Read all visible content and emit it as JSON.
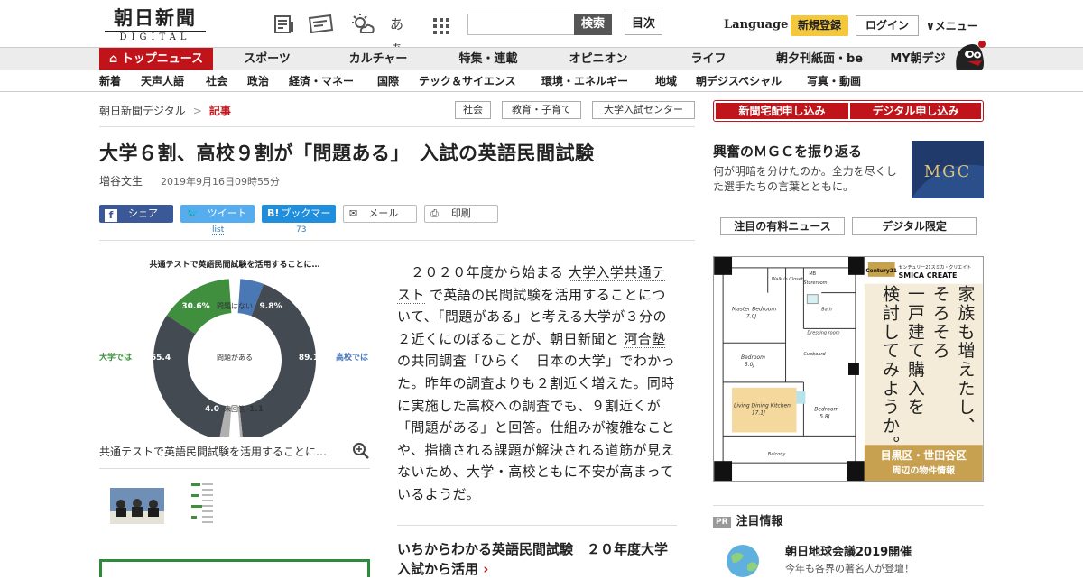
{
  "header": {
    "logo_main": "朝日新聞",
    "logo_sub": "DIGITAL",
    "icons": [
      "newspaper-icon",
      "ticket-icon",
      "weather-icon",
      "font-size-icon",
      "grid-icon"
    ],
    "font_icon_text": "あぁ",
    "search_placeholder": "",
    "search_button": "検索",
    "toc_button": "目次",
    "language": "Language",
    "register_button": "新規登録",
    "login_button": "ログイン",
    "menu_button": "∨メニュー"
  },
  "nav_primary": [
    {
      "label": "トップニュース",
      "active": true
    },
    {
      "label": "スポーツ"
    },
    {
      "label": "カルチャー"
    },
    {
      "label": "特集・連載"
    },
    {
      "label": "オピニオン"
    },
    {
      "label": "ライフ"
    },
    {
      "label": "朝夕刊紙面・be"
    },
    {
      "label": "MY朝デジ"
    }
  ],
  "nav_secondary": [
    "新着",
    "天声人語",
    "社会",
    "政治",
    "経済・マネー",
    "国際",
    "テック＆サイエンス",
    "環境・エネルギー",
    "地域",
    "朝デジスペシャル",
    "写真・動画"
  ],
  "breadcrumb": {
    "home": "朝日新聞デジタル",
    "separator": ">",
    "current": "記事"
  },
  "tags": [
    "社会",
    "教育・子育て",
    "大学入試センター"
  ],
  "article": {
    "headline": "大学６割、高校９割が「問題ある」　入試の英語民間試験",
    "author": "増谷文生",
    "date": "2019年9月16日09時55分",
    "share": {
      "facebook": "シェア",
      "twitter": "ツイート",
      "hatena": "ブックマーク",
      "mail": "メール",
      "print": "印刷"
    },
    "share_counts": {
      "twitter": "list",
      "hatena": "73"
    },
    "body_parts": {
      "p1": "２０２０年度から始まる",
      "link1": "大学入学共通テスト",
      "p2": "で英語の民間試験を活用することについて、「問題がある」と考える大学が３分の２近くにのぼることが、朝日新聞と",
      "link2": "河合塾",
      "p3": "の共同調査「ひらく　日本の大学」でわかった。昨年の調査よりも２割近く増えた。同時に実施した高校への調査でも、９割近くが「問題がある」と回答。仕組みが複雑なことや、指摘される課題が解決される道筋が見えないため、大学・高校ともに不安が高まっているようだ。"
    },
    "related_title": "いちからわかる英語民間試験　２０年度大学入試から活用",
    "related_arrow": "›",
    "figure_caption": "共通テストで英語民間試験を活用することに…"
  },
  "chart_data": {
    "type": "pie",
    "title": "共通テストで英語民間試験を活用することに…",
    "legend_left": "大学では",
    "legend_right": "高校では",
    "categories": [
      "問題はない",
      "問題がある",
      "未回答"
    ],
    "series": [
      {
        "name": "大学では",
        "values": [
          30.6,
          65.4,
          4.0
        ]
      },
      {
        "name": "高校では",
        "values": [
          9.8,
          89.1,
          1.1
        ]
      }
    ],
    "labels": {
      "univ_ok": "30.6%",
      "high_ok": "9.8%",
      "univ_problem": "65.4",
      "high_problem": "89.1",
      "univ_none": "4.0",
      "high_none": "1.1",
      "center_ok": "問題はない",
      "center_problem": "問題がある",
      "center_none": "未回答"
    },
    "colors": {
      "ok_univ": "#3f8f3f",
      "ok_high": "#4a78b5",
      "problem": "#444a52",
      "none": "#b0b0b0"
    }
  },
  "sidebar": {
    "delivery_button": "新聞宅配申し込み",
    "digital_button": "デジタル申し込み",
    "promo_title": "興奮のＭＧＣを振り返る",
    "promo_desc": "何が明暗を分けたのか。全力を尽くした選手たちの言葉とともに。",
    "promo_img_text": "MGC",
    "tab1": "注目の有料ニュース",
    "tab2": "デジタル限定",
    "ad": {
      "brand": "センチュリー21スミカ・クリエイト",
      "brand_en": "SMICA CREATE",
      "logo": "Century21",
      "copy_lines": [
        "家族も増えたし、",
        "そろそろ",
        "一戸建て購入を",
        "検討してみようか。"
      ],
      "area": "目黒区・世田谷区",
      "area_sub": "周辺の物件情報",
      "rooms": [
        "Master Bedroom",
        "7.0J",
        "Walk in Closet",
        "Storeroom",
        "Bedroom",
        "5.0J",
        "Living Dining Kitchen",
        "17.1J",
        "Bedroom",
        "5.8J",
        "Balcony",
        "Bath",
        "Dressing room",
        "Cupboard",
        "MB"
      ]
    },
    "pr_badge": "PR",
    "pr_head": "注目情報",
    "pr_title": "朝日地球会議2019開催",
    "pr_sub": "今年も各界の著名人が登壇！"
  }
}
